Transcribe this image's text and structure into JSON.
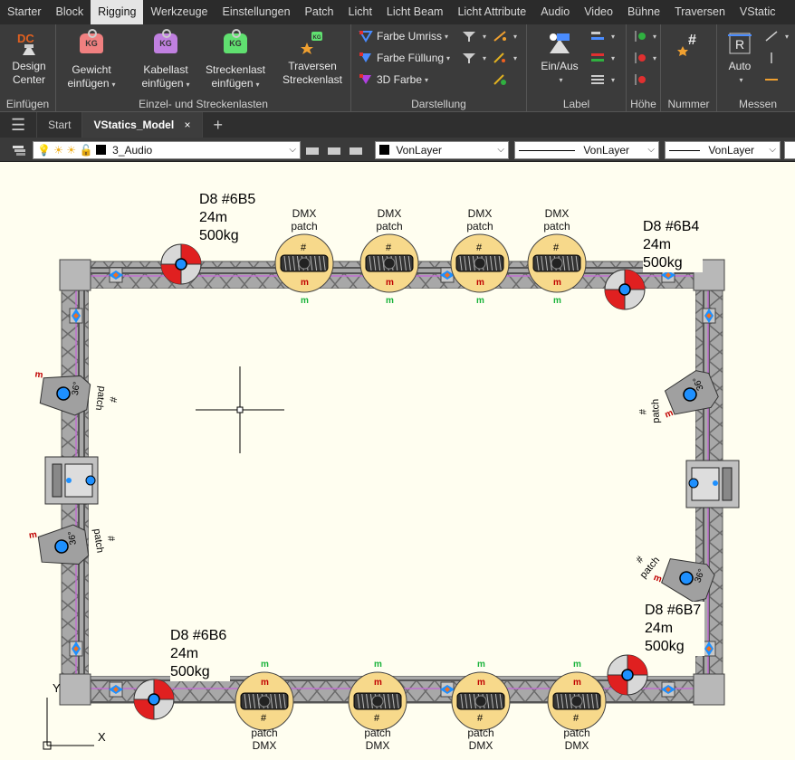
{
  "ribbon_tabs": [
    "Starter",
    "Block",
    "Rigging",
    "Werkzeuge",
    "Einstellungen",
    "Patch",
    "Licht",
    "Licht Beam",
    "Licht Attribute",
    "Audio",
    "Video",
    "Bühne",
    "Traversen",
    "VStatic"
  ],
  "active_ribbon_tab": "Rigging",
  "panels": {
    "einfuegen": {
      "title": "Einfügen",
      "design_center_line1": "Design",
      "design_center_line2": "Center"
    },
    "lasten": {
      "title": "Einzel- und Streckenlasten",
      "gewicht_line1": "Gewicht",
      "gewicht_line2": "einfügen",
      "kabellast_line1": "Kabellast",
      "kabellast_line2": "einfügen",
      "streckenlast_line1": "Streckenlast",
      "streckenlast_line2": "einfügen",
      "traversen_line1": "Traversen",
      "traversen_line2": "Streckenlast",
      "kg": "KG"
    },
    "darstellung": {
      "title": "Darstellung",
      "farbe_umriss": "Farbe Umriss",
      "farbe_fuellung": "Farbe Füllung",
      "farbe_3d": "3D Farbe"
    },
    "label": {
      "title": "Label",
      "ein_aus": "Ein/Aus"
    },
    "hoehe": {
      "title": "Höhe"
    },
    "nummer": {
      "title": "Nummer"
    },
    "messen": {
      "title": "Messen",
      "auto": "Auto"
    }
  },
  "doc_tabs": {
    "start": "Start",
    "model": "VStatics_Model",
    "close": "×",
    "add": "+"
  },
  "propbar": {
    "layer": "3_Audio",
    "color": "VonLayer",
    "linetype": "VonLayer",
    "lineweight": "VonLayer"
  },
  "motors": [
    {
      "label": "D8  #6B5",
      "length": "24m",
      "load": "500kg"
    },
    {
      "label": "D8  #6B4",
      "length": "24m",
      "load": "500kg"
    },
    {
      "label": "D8  #6B6",
      "length": "24m",
      "load": "500kg"
    },
    {
      "label": "D8  #6B7",
      "length": "24m",
      "load": "500kg"
    }
  ],
  "fixture_text": {
    "dmx": "DMX",
    "patch": "patch",
    "hash": "#",
    "m": "m",
    "beam": "36°"
  },
  "colors": {
    "ribbon_bg": "#3b3b3b",
    "canvas_bg": "#fffef0",
    "truss": "#9a9a9a",
    "fixture_fill": "#f7d98b",
    "motor_red": "#e02020",
    "accent_blue": "#1e90ff"
  }
}
